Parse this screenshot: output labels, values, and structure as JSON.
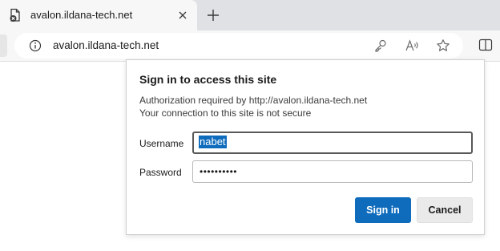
{
  "browser": {
    "tab": {
      "title": "avalon.ildana-tech.net"
    },
    "address_bar": {
      "url": "avalon.ildana-tech.net"
    },
    "icons": [
      "page-icon",
      "close-icon",
      "plus-icon",
      "info-icon",
      "key-icon",
      "read-aloud-icon",
      "star-icon",
      "split-screen-icon"
    ]
  },
  "dialog": {
    "title": "Sign in to access this site",
    "line1": "Authorization required by http://avalon.ildana-tech.net",
    "line2": "Your connection to this site is not secure",
    "username_label": "Username",
    "username_value": "nabet",
    "password_label": "Password",
    "password_value": "••••••••••",
    "signin_label": "Sign in",
    "cancel_label": "Cancel",
    "accent_color": "#0f6cbd"
  }
}
